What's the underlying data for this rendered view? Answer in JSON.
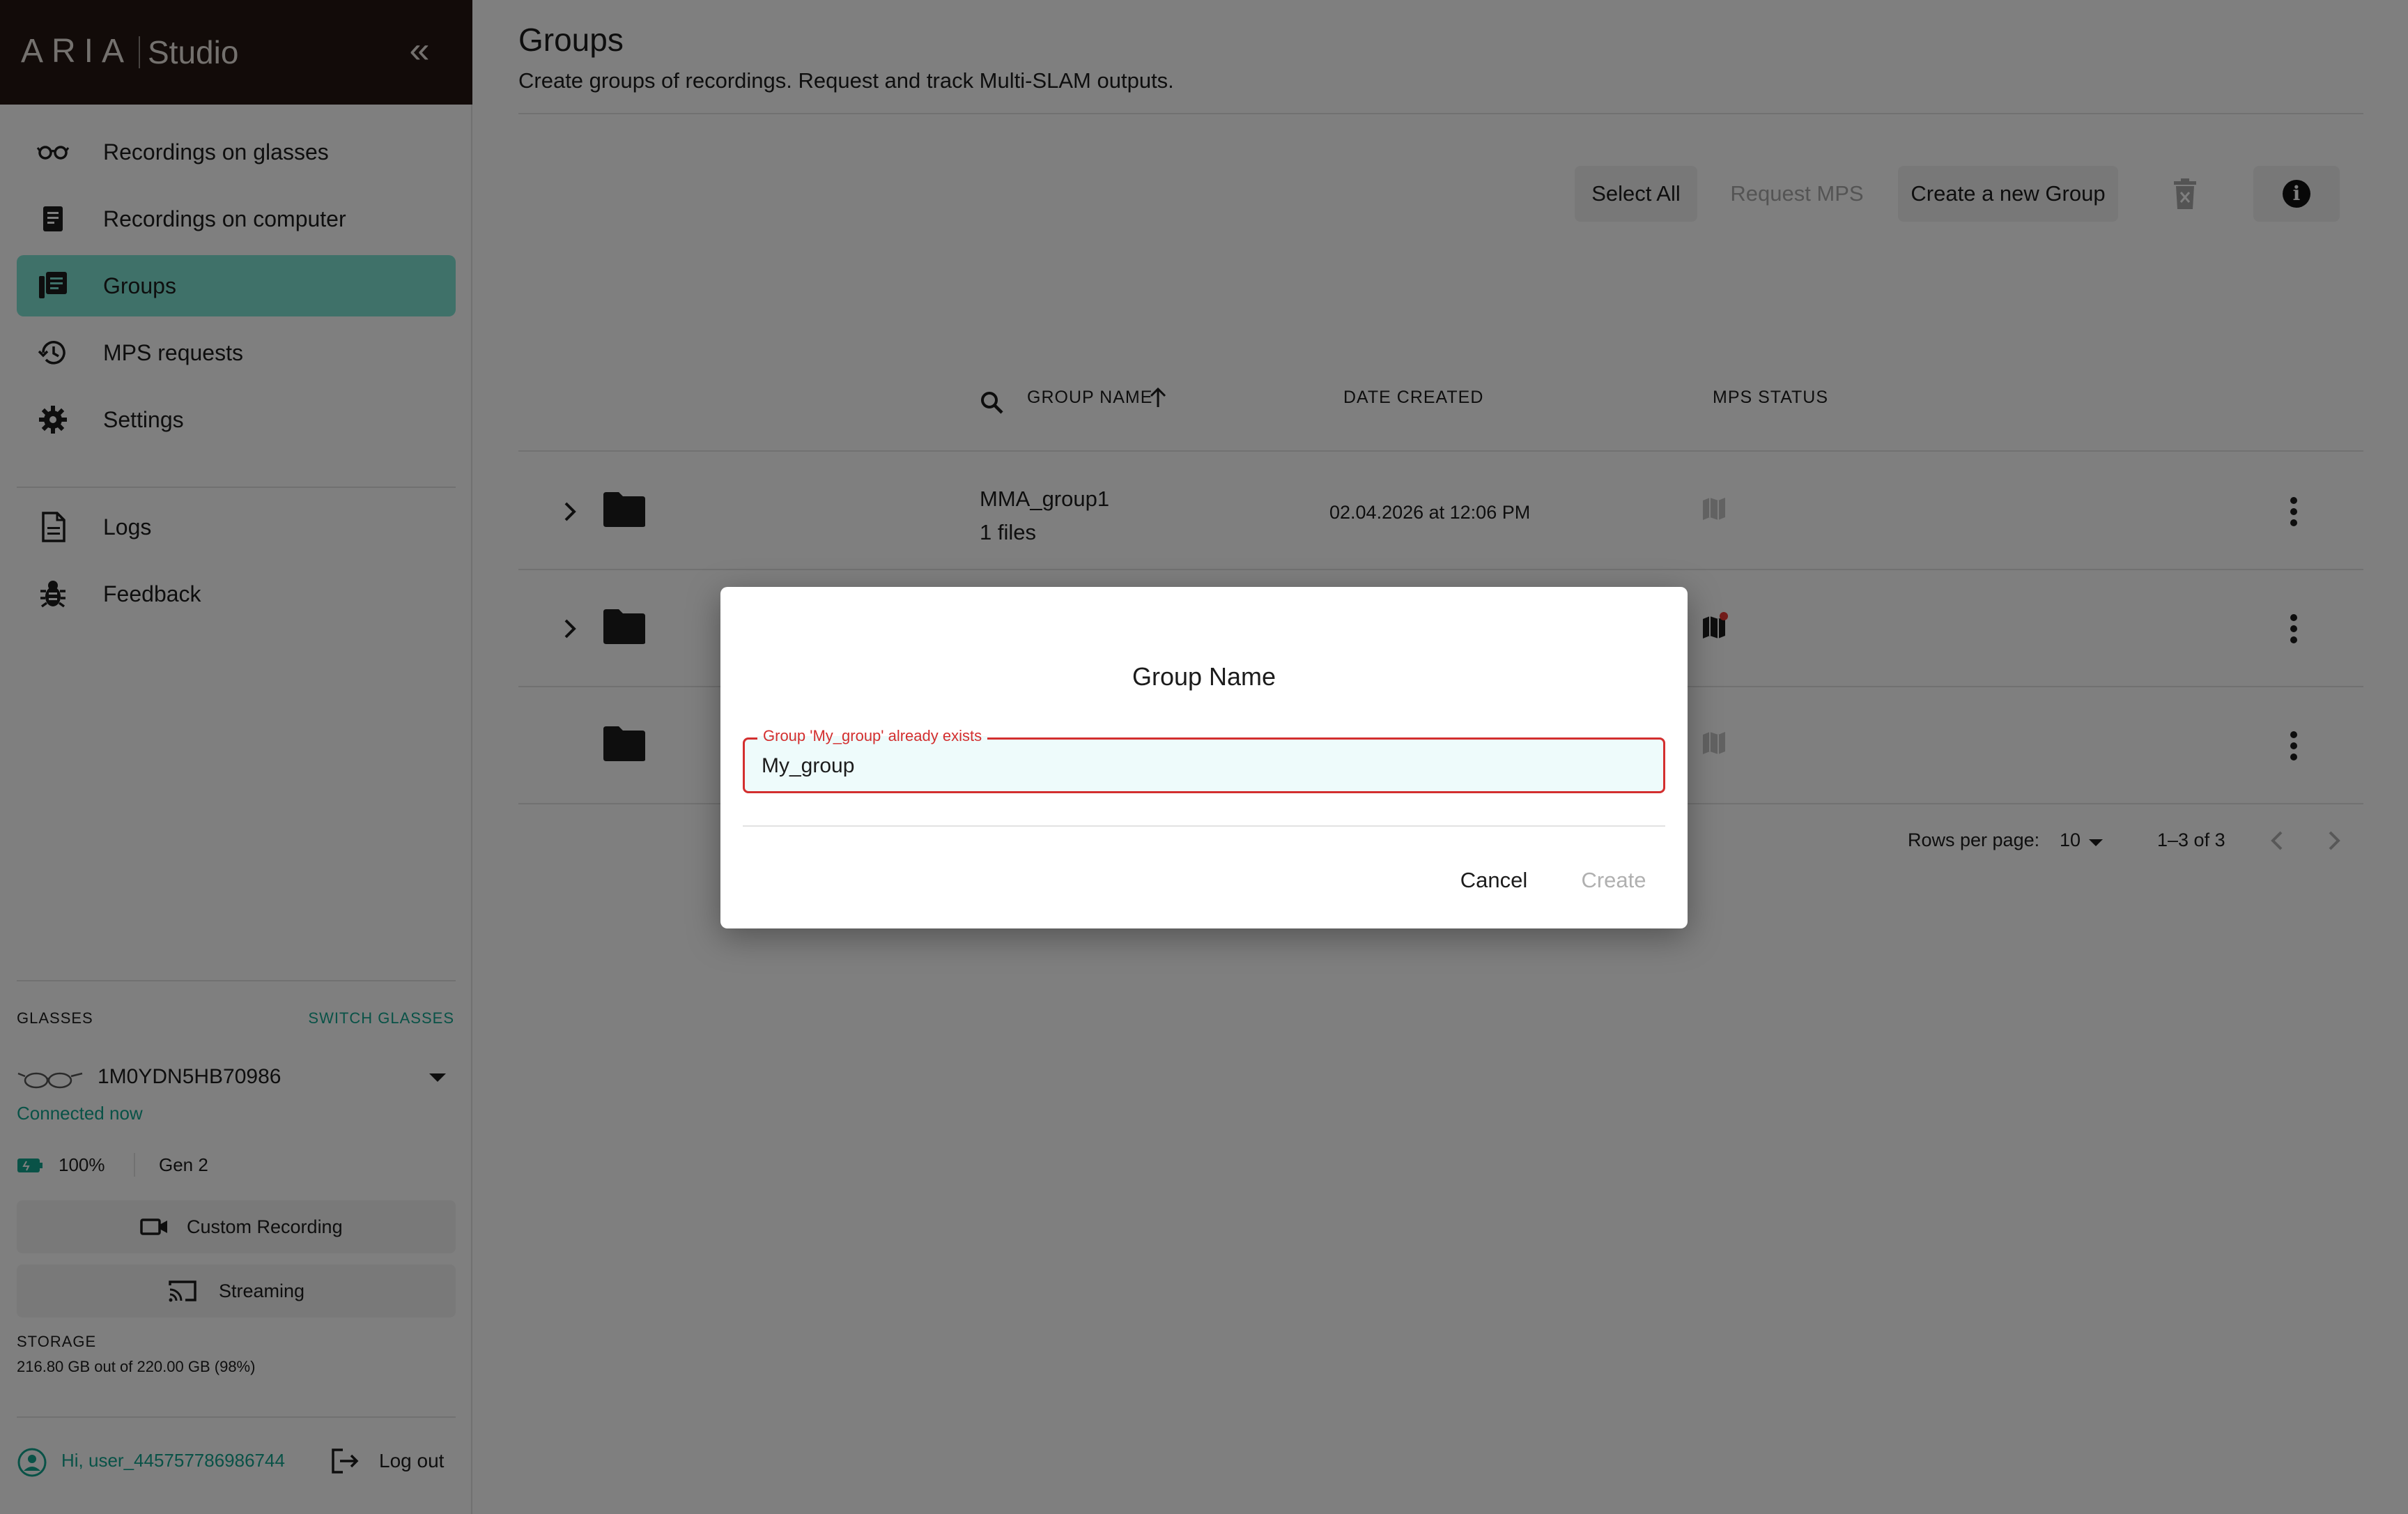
{
  "brand": {
    "wordmark": "ARIA",
    "product": "Studio"
  },
  "sidebar": {
    "items": [
      {
        "label": "Recordings on glasses",
        "icon": "glasses-icon"
      },
      {
        "label": "Recordings on computer",
        "icon": "document-icon"
      },
      {
        "label": "Groups",
        "icon": "group-folder-icon",
        "active": true
      },
      {
        "label": "MPS requests",
        "icon": "history-icon"
      },
      {
        "label": "Settings",
        "icon": "gear-icon"
      }
    ],
    "secondary": [
      {
        "label": "Logs",
        "icon": "log-file-icon"
      },
      {
        "label": "Feedback",
        "icon": "bug-icon"
      }
    ],
    "glasses": {
      "header": "GLASSES",
      "switch_label": "SWITCH GLASSES",
      "device_id": "1M0YDN5HB70986",
      "status": "Connected now",
      "battery": "100%",
      "generation": "Gen 2"
    },
    "custom_recording": "Custom Recording",
    "streaming": "Streaming",
    "storage": {
      "header": "STORAGE",
      "value": "216.80 GB out of 220.00 GB (98%)"
    },
    "user": {
      "greeting": "Hi, user_445757786986744",
      "logout": "Log out"
    }
  },
  "main": {
    "title": "Groups",
    "subtitle": "Create groups of recordings. Request and track Multi-SLAM outputs.",
    "toolbar": {
      "select_all": "Select All",
      "request_mps": "Request MPS",
      "create_group": "Create a new Group"
    },
    "table": {
      "columns": {
        "name": "GROUP NAME",
        "date": "DATE CREATED",
        "status": "MPS STATUS"
      },
      "rows": [
        {
          "name": "MMA_group1",
          "files": "1 files",
          "date": "02.04.2026 at 12:06 PM"
        },
        {
          "name": "",
          "files": "",
          "date": ""
        },
        {
          "name": "",
          "files": "",
          "date": ""
        }
      ]
    },
    "pagination": {
      "rows_label": "Rows per page:",
      "rows_value": "10",
      "range": "1–3 of 3"
    }
  },
  "dialog": {
    "title": "Group Name",
    "error": "Group 'My_group' already exists",
    "value": "My_group",
    "cancel": "Cancel",
    "create": "Create"
  },
  "colors": {
    "brand_bg": "#241612",
    "accent": "#7fe3d3",
    "accent_text": "#12a58e",
    "error": "#d32f2f",
    "notification": "#e53935"
  }
}
